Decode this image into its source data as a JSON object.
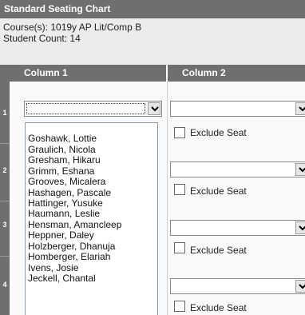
{
  "header": {
    "title": "Standard Seating Chart"
  },
  "info": {
    "course": "Course(s): 1019y AP Lit/Comp B",
    "count": "Student Count: 14"
  },
  "columns": [
    {
      "label": "Column 1"
    },
    {
      "label": "Column 2"
    }
  ],
  "rows": [
    {
      "num": "1"
    },
    {
      "num": "2"
    },
    {
      "num": "3"
    },
    {
      "num": "4"
    }
  ],
  "seat": {
    "exclude_label": "Exclude Seat"
  },
  "dropdown": {
    "options": [
      "",
      "Goshawk, Lottie",
      "Graulich, Nicola",
      "Gresham, Hikaru",
      "Grimm, Eshana",
      "Grooves, Micalera",
      "Hashagen, Pascale",
      "Hattinger, Yusuke",
      "Haumann, Leslie",
      "Hensman, Amancleep",
      "Heppner, Daley",
      "Holzberger, Dhanuja",
      "Homberger, Elariah",
      "Ivens, Josie",
      "Jeckell, Chantal"
    ]
  }
}
